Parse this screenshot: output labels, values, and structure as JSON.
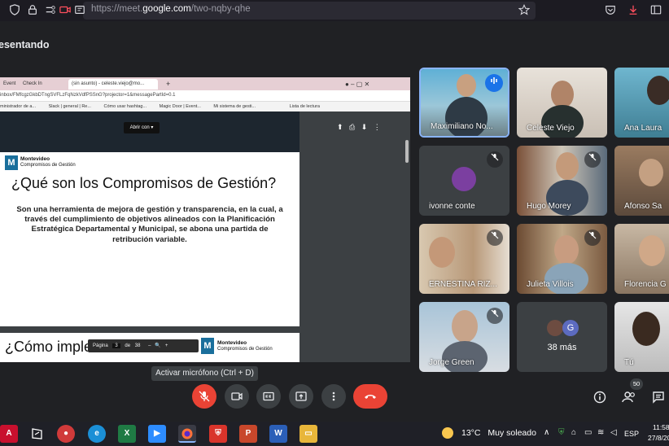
{
  "browser": {
    "url_prefix": "https://meet.",
    "url_domain": "google.com",
    "url_path": "/two-nqby-qhe"
  },
  "meet": {
    "presenting_label": "esentando"
  },
  "shared_screen": {
    "tabs": [
      "Event",
      "Check In",
      "(sin asunto) - celeste.viejo@mo..."
    ],
    "address": "inbox/FMfcgzGkbDTngSVFLzFqNzkVdfPSSnG?projector=1&messagePartId=0.1",
    "bookmarks": [
      "ministrador de a...",
      "Slack | general | Re...",
      "Cómo usar hashtag...",
      "Magic Door | Event...",
      "Mi sistema de gesti...",
      "Lista de lectura"
    ],
    "open_with": "Abrir con",
    "slide_org": "Montevideo",
    "slide_org_sub": "Compromisos de Gestión",
    "slide_title": "¿Qué son los Compromisos de Gestión?",
    "slide_body": "Son una herramienta de mejora de gestión y transparencia, en la cual, a través del cumplimiento de objetivos alineados con la Planificación Estratégica Departamental y Municipal, se abona una partida de retribución variable.",
    "slide2_title": "¿Cómo implementamos?",
    "page_label": "Página",
    "page_num": "3",
    "page_of": "de",
    "page_total": "38"
  },
  "participants": [
    {
      "name": "Maximiliano No...",
      "speaking": true
    },
    {
      "name": "Celeste Viejo"
    },
    {
      "name": "Ana Laura"
    },
    {
      "name": "ivonne conte",
      "muted": true
    },
    {
      "name": "Hugo Morey",
      "muted": true
    },
    {
      "name": "Afonso Sa",
      "muted": true
    },
    {
      "name": "ERNESTINA RIZ...",
      "muted": true
    },
    {
      "name": "Julieta Villois",
      "muted": true
    },
    {
      "name": "Florencia G"
    },
    {
      "name": "Jorge Green",
      "muted": true
    },
    {
      "name": "38 más",
      "avatar_letter": "G"
    },
    {
      "name": "Tú"
    }
  ],
  "tooltip": "Activar micrófono (Ctrl + D)",
  "participant_count": "50",
  "taskbar": {
    "temperature": "13°C",
    "weather": "Muy soleado",
    "lang": "ESP",
    "time": "11:58",
    "date": "27/8/20"
  },
  "colors": {
    "accent": "#8ab4f8",
    "danger": "#ea4335",
    "bg": "#202124"
  }
}
